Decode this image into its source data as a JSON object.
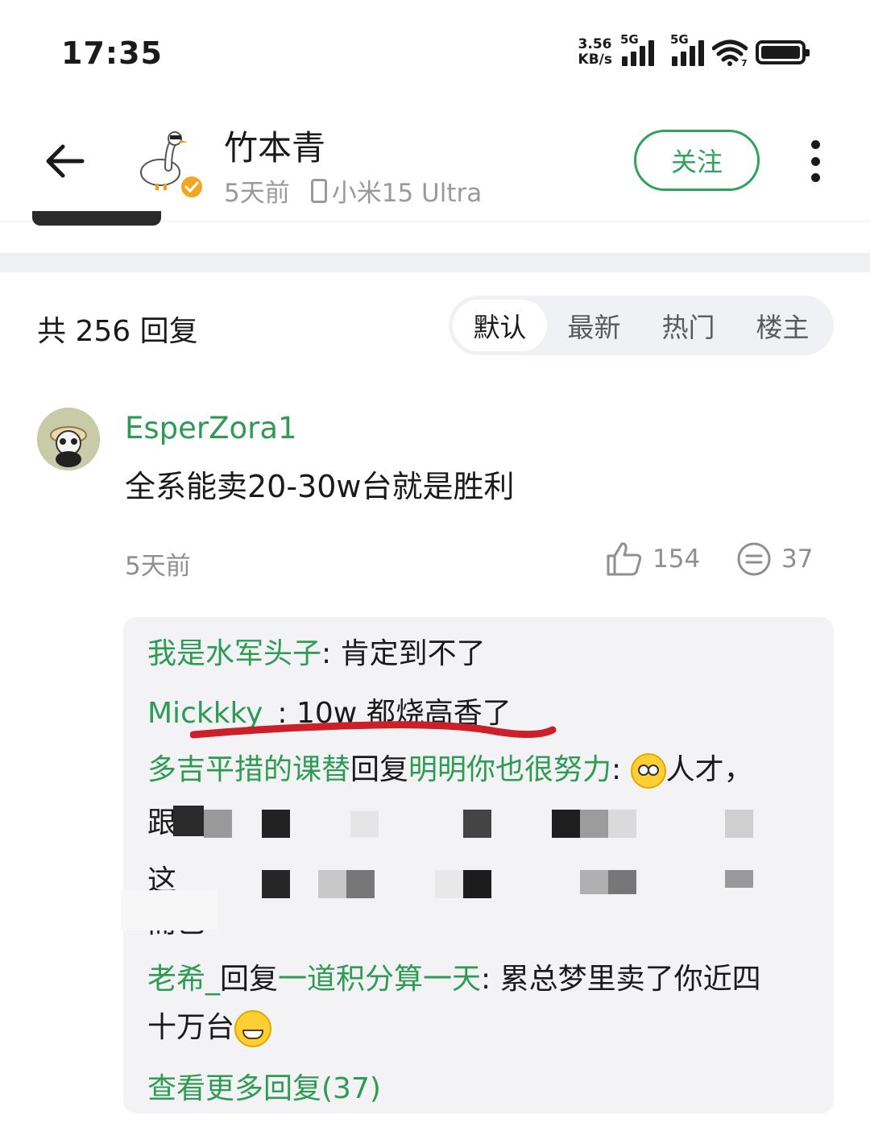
{
  "status_bar": {
    "time": "17:35",
    "net_speed_value": "3.56",
    "net_speed_unit": "KB/s",
    "sim1": "5G",
    "sim2": "5G",
    "wifi_badge": "7"
  },
  "header": {
    "author_name": "竹本青",
    "post_time": "5天前",
    "device": "小米15 Ultra",
    "follow_label": "关注"
  },
  "replies_header": {
    "count_text": "共 256 回复",
    "sort_tabs": [
      "默认",
      "最新",
      "热门",
      "楼主"
    ],
    "active_tab": "默认"
  },
  "comment": {
    "username": "EsperZora1",
    "text": "全系能卖20-30w台就是胜利",
    "time": "5天前",
    "likes": "154",
    "replies": "37"
  },
  "sub_replies": [
    {
      "user": "我是水军头子",
      "sep": ": ",
      "text": "肯定到不了"
    },
    {
      "user": "Mickkky_",
      "sep": ": ",
      "text": "10w 都烧高香了"
    },
    {
      "user": "多吉平措的课替",
      "reply_word": "回复",
      "target": "明明你也很努力",
      "sep": ": ",
      "text": "人才，",
      "cont1": "跟",
      "cont2": "这",
      "cont3": "而已"
    },
    {
      "user": "老希_",
      "reply_word": "回复",
      "target": "一道积分算一天",
      "sep": ": ",
      "text": "累总梦里卖了你近四",
      "cont1": "十万台"
    }
  ],
  "more_replies": "查看更多回复(37)",
  "colors": {
    "accent_green": "#2e9b55",
    "muted_text": "#8f8f8f",
    "sub_box_bg": "#f3f3f5",
    "annotation_red": "#cc1f2a"
  }
}
